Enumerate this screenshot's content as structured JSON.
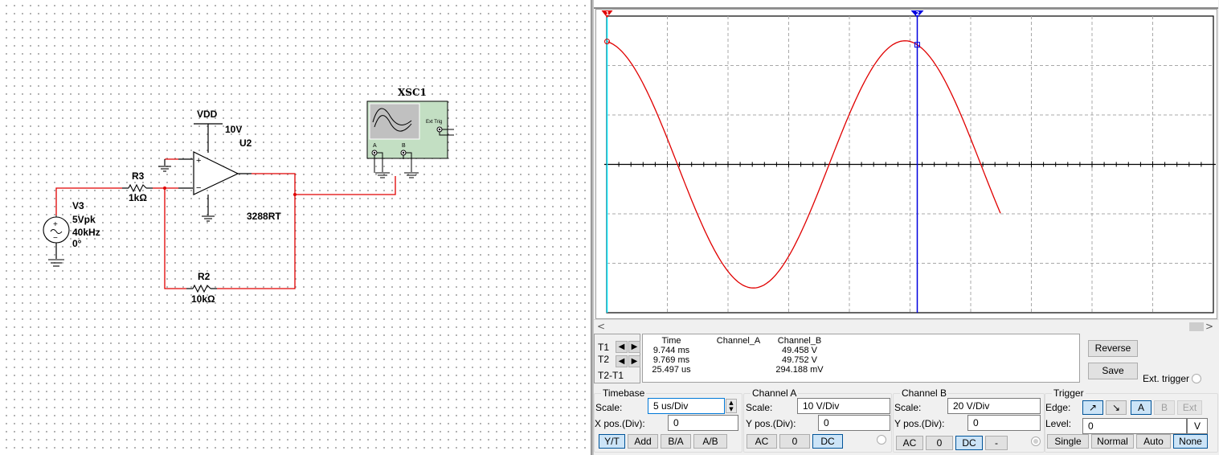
{
  "schematic": {
    "source": {
      "name": "V3",
      "amplitude": "5Vpk",
      "frequency": "40kHz",
      "phase": "0°"
    },
    "r_input": {
      "name": "R3",
      "value": "1kΩ"
    },
    "r_feedback": {
      "name": "R2",
      "value": "10kΩ"
    },
    "opamp": {
      "name": "U2",
      "model": "3288RT",
      "supply_label": "VDD",
      "supply_value": "10V"
    },
    "scope_instrument": {
      "name": "XSC1",
      "ext_trig_label": "Ext Trig",
      "channel_a": "A",
      "channel_b": "B"
    },
    "wire_color": "#e00000"
  },
  "oscilloscope": {
    "display": {
      "trace_color": "#e00000",
      "cursor1_color": "#00e5ff",
      "cursor2_color": "#0000e0",
      "cursor1_label": "1",
      "cursor2_label": "2",
      "divisions_x": 10,
      "divisions_y": 6
    },
    "chart_data": {
      "type": "line",
      "title": "",
      "series": [
        {
          "name": "Channel_B",
          "shape": "sine",
          "amplitude_V": 50,
          "frequency_kHz": 40,
          "time_span_us": 32.5,
          "phase_at_start_deg": 96
        }
      ],
      "x_unit": "us",
      "x_per_div": 5,
      "y_unit": "V",
      "y_per_div": 20,
      "ylim": [
        -60,
        60
      ],
      "xlim_div": [
        0,
        10
      ],
      "grid": true
    },
    "cursor_table": {
      "row_labels": [
        "T1",
        "T2",
        "T2-T1"
      ],
      "headers": [
        "Time",
        "Channel_A",
        "Channel_B"
      ],
      "rows": [
        {
          "time": "9.744 ms",
          "channel_a": "",
          "channel_b": "49.458 V"
        },
        {
          "time": "9.769 ms",
          "channel_a": "",
          "channel_b": "49.752 V"
        },
        {
          "time": "25.497 us",
          "channel_a": "",
          "channel_b": "294.188 mV"
        }
      ]
    },
    "buttons": {
      "reverse": "Reverse",
      "save": "Save",
      "ext_trigger": "Ext. trigger"
    },
    "timebase": {
      "title": "Timebase",
      "scale_label": "Scale:",
      "scale_value": "5 us/Div",
      "xpos_label": "X pos.(Div):",
      "xpos_value": "0",
      "modes": [
        "Y/T",
        "Add",
        "B/A",
        "A/B"
      ],
      "selected_mode": "Y/T"
    },
    "channel_a": {
      "title": "Channel A",
      "scale_label": "Scale:",
      "scale_value": "10  V/Div",
      "ypos_label": "Y pos.(Div):",
      "ypos_value": "0",
      "coupling": [
        "AC",
        "0",
        "DC"
      ],
      "selected_coupling": "DC"
    },
    "channel_b": {
      "title": "Channel B",
      "scale_label": "Scale:",
      "scale_value": "20  V/Div",
      "ypos_label": "Y pos.(Div):",
      "ypos_value": "0",
      "coupling": [
        "AC",
        "0",
        "DC",
        "-"
      ],
      "selected_coupling": "DC"
    },
    "trigger": {
      "title": "Trigger",
      "edge_label": "Edge:",
      "edge_rising": "↗",
      "edge_falling": "↘",
      "sources": [
        "A",
        "B",
        "Ext"
      ],
      "selected_source": "A",
      "level_label": "Level:",
      "level_value": "0",
      "level_unit": "V",
      "modes": [
        "Single",
        "Normal",
        "Auto",
        "None"
      ],
      "selected_mode": "None"
    }
  }
}
